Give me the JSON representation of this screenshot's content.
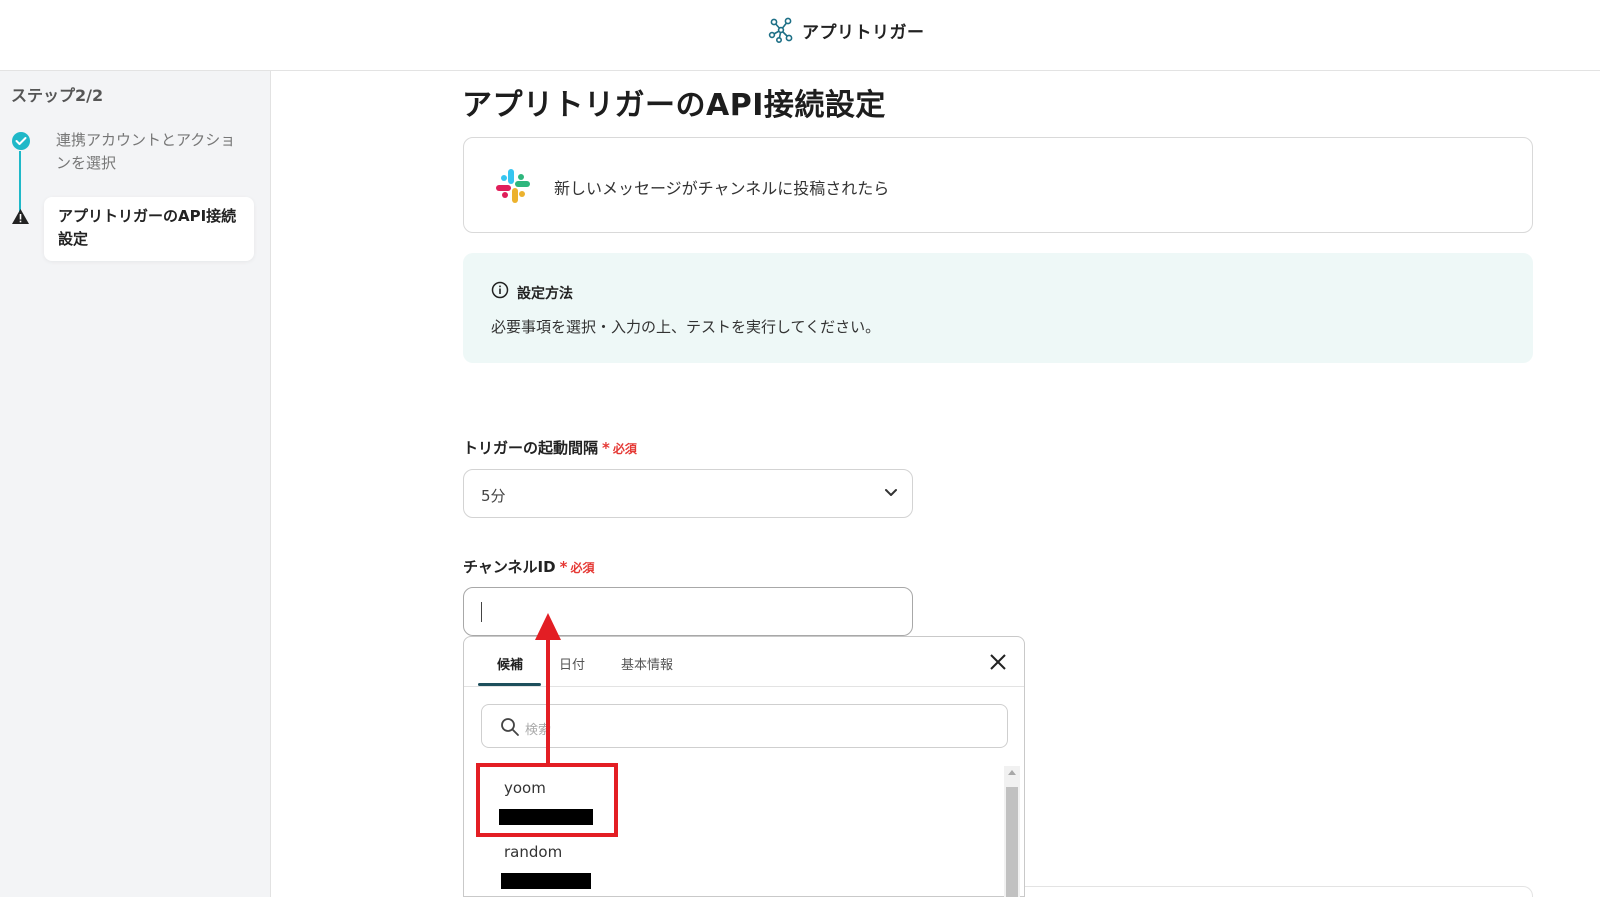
{
  "header": {
    "title": "アプリトリガー",
    "icon": "trigger-network-icon"
  },
  "sidebar": {
    "step_count": "ステップ2/2",
    "steps": [
      {
        "label": "連携アカウントとアクションを選択",
        "status": "completed",
        "icon": "check-icon"
      },
      {
        "label": "アプリトリガーのAPI接続設定",
        "status": "current",
        "icon": "warning-icon"
      }
    ]
  },
  "main": {
    "page_title": "アプリトリガーのAPI接続設定",
    "trigger_card": {
      "app_icon": "slack-logo",
      "text": "新しいメッセージがチャンネルに投稿されたら"
    },
    "info_box": {
      "title": "設定方法",
      "description": "必要事項を選択・入力の上、テストを実行してください。",
      "icon": "info-icon"
    },
    "interval_field": {
      "label": "トリガーの起動間隔",
      "required_mark": "*",
      "required_text": "必須",
      "value": "5分"
    },
    "channel_field": {
      "label": "チャンネルID",
      "required_mark": "*",
      "required_text": "必須",
      "value": ""
    }
  },
  "dropdown": {
    "tabs": [
      {
        "label": "候補",
        "active": true
      },
      {
        "label": "日付",
        "active": false
      },
      {
        "label": "基本情報",
        "active": false
      }
    ],
    "search_placeholder": "検索",
    "items": [
      {
        "name": "yoom",
        "redacted": true
      },
      {
        "name": "random",
        "redacted": true
      }
    ]
  },
  "colors": {
    "accent_teal": "#1fb8c8",
    "required_red": "#e53935",
    "annotation_red": "#e31e24",
    "info_bg": "#eef8f7",
    "tab_underline": "#1d4f5c"
  }
}
